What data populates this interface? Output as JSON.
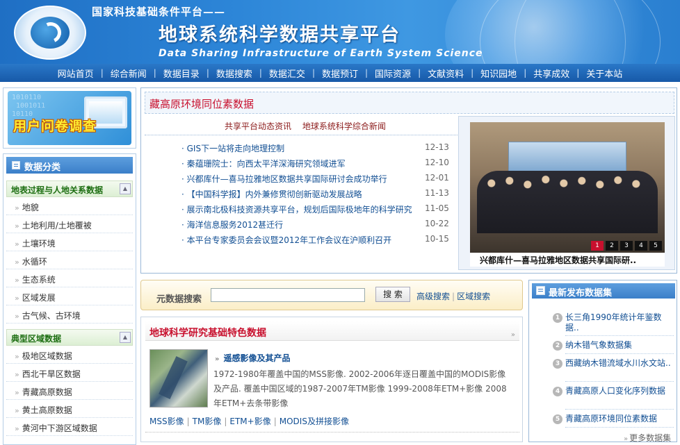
{
  "header": {
    "subtitle": "国家科技基础条件平台——",
    "title": "地球系统科学数据共享平台",
    "en_title": "Data Sharing Infrastructure of Earth System Science",
    "logo_icon": "platform-logo"
  },
  "nav": {
    "items": [
      "网站首页",
      "综合新闻",
      "数据目录",
      "数据搜索",
      "数据汇交",
      "数据预订",
      "国际资源",
      "文献资料",
      "知识园地",
      "共享成效",
      "关于本站"
    ]
  },
  "survey": {
    "label": "用户问卷调查",
    "binary": "1010110\n 1001011\n10110",
    "icon": "monitor-icon"
  },
  "categories": {
    "title": "数据分类",
    "groups": [
      {
        "name": "地表过程与人地关系数据",
        "items": [
          "地貌",
          "土地利用/土地覆被",
          "土壤环境",
          "水循环",
          "生态系统",
          "区域发展",
          "古气候、古环境"
        ]
      },
      {
        "name": "典型区域数据",
        "items": [
          "极地区域数据",
          "西北干旱区数据",
          "青藏高原数据",
          "黄土高原数据",
          "黄河中下游区域数据"
        ]
      }
    ]
  },
  "news": {
    "banner_title": "藏高原环境同位素数据",
    "tabs": [
      "共享平台动态资讯",
      "地球系统科学综合新闻"
    ],
    "items": [
      {
        "title": "· GIS下一站将走向地理控制",
        "date": "12-13"
      },
      {
        "title": "· 秦蕴珊院士：向西太平洋深海研究领域进军",
        "date": "12-10"
      },
      {
        "title": "· 兴都库什—喜马拉雅地区数据共享国际研讨会成功举行",
        "date": "12-01"
      },
      {
        "title": "· 【中国科学报】内外兼修贯彻创新驱动发展战略",
        "date": "11-13"
      },
      {
        "title": "· 展示南北极科技资源共享平台，规划后国际极地年的科学研究",
        "date": "11-05"
      },
      {
        "title": "· 海洋信息服务2012甚迁行",
        "date": "10-22"
      },
      {
        "title": "· 本平台专家委员会会议暨2012年工作会议在沪顺利召开",
        "date": "10-15"
      }
    ],
    "photo_caption": "兴都库什—喜马拉雅地区数据共享国际研..",
    "pager": [
      "1",
      "2",
      "3",
      "4",
      "5"
    ]
  },
  "search": {
    "label": "元数据搜索",
    "placeholder": "",
    "button": "搜 索",
    "advanced": "高级搜索",
    "region": "区域搜索"
  },
  "featured": {
    "title": "地球科学研究基础特色数据",
    "more": "»",
    "name": "遥感影像及其产品",
    "description": "1972-1980年覆盖中国的MSS影像. 2002-2006年逐日覆盖中国的MODIS影像及产品. 覆盖中国区域的1987-2007年TM影像 1999-2008年ETM+影像 2008年ETM+去条带影像",
    "links": [
      "MSS影像",
      "TM影像",
      "ETM+影像",
      "MODIS及拼接影像"
    ]
  },
  "latest": {
    "title": "最新发布数据集",
    "items": [
      {
        "num": "1",
        "text": "长三角1990年统计年鉴数据.."
      },
      {
        "num": "2",
        "text": "纳木错气象数据集"
      },
      {
        "num": "3",
        "text": "西藏纳木错流域水川水文站.."
      },
      {
        "num": "4",
        "text": "青藏高原人口变化序列数据"
      },
      {
        "num": "5",
        "text": "青藏高原环境同位素数据"
      }
    ],
    "more": "更多数据集"
  },
  "colors": {
    "brand_blue": "#1f6fc4",
    "nav_blue": "#1759a8",
    "accent_red": "#c8102e",
    "link_blue": "#124f93",
    "category_green": "#1d6e12"
  }
}
